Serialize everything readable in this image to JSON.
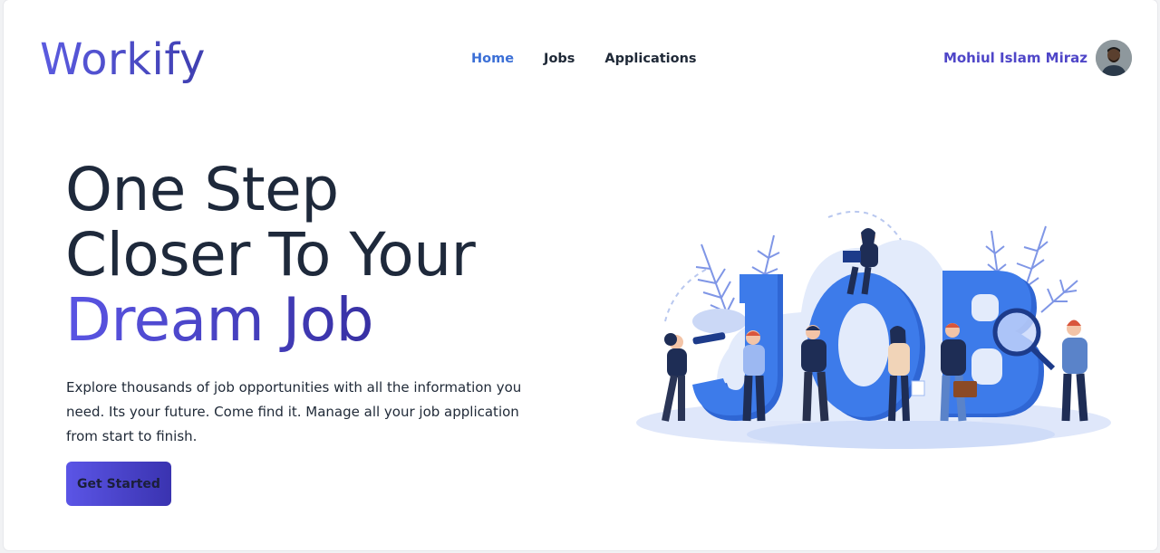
{
  "brand": {
    "logo": "Workify"
  },
  "nav": {
    "items": [
      {
        "label": "Home",
        "active": true
      },
      {
        "label": "Jobs",
        "active": false
      },
      {
        "label": "Applications",
        "active": false
      }
    ]
  },
  "user": {
    "name": "Mohiul Islam Miraz",
    "avatar_icon": "user-avatar"
  },
  "hero": {
    "title_line1": "One Step",
    "title_line2": "Closer To Your",
    "title_accent": "Dream Job",
    "description": "Explore thousands of job opportunities with all the information you need. Its your future. Come find it. Manage all your job application from start to finish.",
    "cta_label": "Get Started",
    "illustration_text": "JOB"
  },
  "colors": {
    "accent": "#4f46c8",
    "nav_active": "#3b6fd6",
    "illustration_blue": "#3d7bea"
  }
}
